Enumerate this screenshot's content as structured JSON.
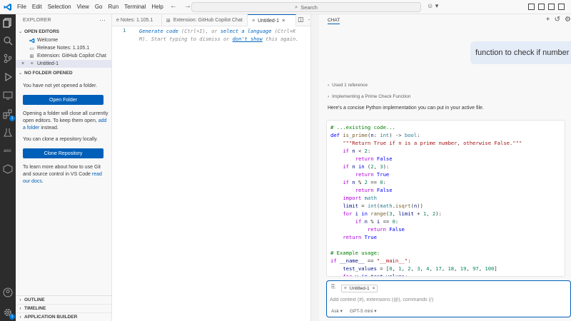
{
  "menu": [
    "File",
    "Edit",
    "Selection",
    "View",
    "Go",
    "Run",
    "Terminal",
    "Help"
  ],
  "search": {
    "placeholder": "Search"
  },
  "sidebar": {
    "title": "EXPLORER",
    "open_editors_header": "OPEN EDITORS",
    "open_editors": [
      {
        "label": "Welcome",
        "icon": "vscode-icon"
      },
      {
        "label": "Release Notes: 1.105.1",
        "icon": "file-icon"
      },
      {
        "label": "Extension: GitHub Copilot Chat",
        "icon": "extensions-icon"
      },
      {
        "label": "Untitled-1",
        "icon": "file-icon",
        "active": true
      }
    ],
    "no_folder_header": "NO FOLDER OPENED",
    "no_folder_text": "You have not yet opened a folder.",
    "open_folder_button": "Open Folder",
    "open_folder_info_1": "Opening a folder will close all currently open editors. To keep them open,",
    "add_folder_link": "add a folder",
    "open_folder_info_2": "instead.",
    "clone_text": "You can clone a repository locally.",
    "clone_button": "Clone Repository",
    "learn_text": "To learn more about how to use Git and source control in VS Code",
    "read_docs_link": "read our docs",
    "bottom_sections": [
      "OUTLINE",
      "TIMELINE",
      "APPLICATION BUILDER"
    ]
  },
  "tabs": [
    {
      "label": "e Notes: 1.105.1",
      "active": false
    },
    {
      "label": "Extension: GitHub Copilot Chat",
      "active": false
    },
    {
      "label": "Untitled-1",
      "active": true
    }
  ],
  "editor": {
    "line_number": "1",
    "hint_generate": "Generate code",
    "hint_generate_key": "(Ctrl+I), or",
    "hint_select_lang": "select a language",
    "hint_select_key": "(Ctrl+K M). Start typing to dismiss or",
    "hint_dont_show": "don't show",
    "hint_end": "this again."
  },
  "chat": {
    "header": "CHAT",
    "user_message": "function to check if number",
    "used_reference": "Used 1 reference",
    "implementing": "Implementing a Prime Check Function",
    "answer_intro": "Here's a concise Python implementation you can put in your active file.",
    "input_chip": "Untitled-1",
    "input_placeholder": "Add context (#), extensions (@), commands (/)",
    "mode": "Ask",
    "model": "GPT-5 mini"
  },
  "colors": {
    "accent": "#005fb8",
    "activity_bar": "#2c2c2c",
    "sidebar_bg": "#f8f8f8"
  }
}
